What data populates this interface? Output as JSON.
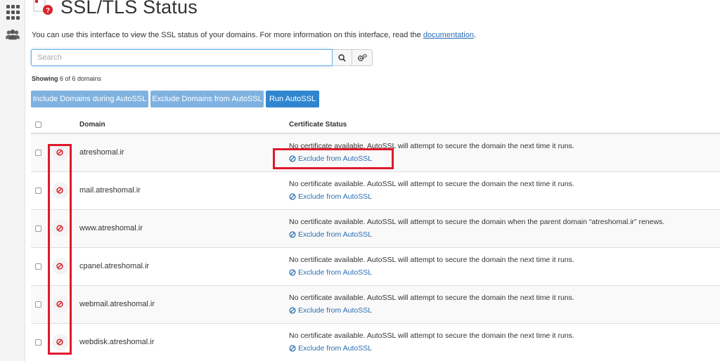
{
  "page": {
    "title": "SSL/TLS Status",
    "intro_text": "You can use this interface to view the SSL status of your domains. For more information on this interface, read the ",
    "intro_link": "documentation",
    "intro_end": "."
  },
  "sidebar": {
    "icons": [
      "grid-icon",
      "users-icon"
    ]
  },
  "search": {
    "placeholder": "Search",
    "value": ""
  },
  "showing": {
    "label": "Showing",
    "text": "6 of 6 domains"
  },
  "actions": {
    "include": "Include Domains during AutoSSL",
    "exclude": "Exclude Domains from AutoSSL",
    "run": "Run AutoSSL"
  },
  "table": {
    "headers": {
      "domain": "Domain",
      "status": "Certificate Status"
    },
    "rows": [
      {
        "domain": "atreshomal.ir",
        "message": "No certificate available. AutoSSL will attempt to secure the domain the next time it runs.",
        "link": "Exclude from AutoSSL"
      },
      {
        "domain": "mail.atreshomal.ir",
        "message": "No certificate available. AutoSSL will attempt to secure the domain the next time it runs.",
        "link": "Exclude from AutoSSL"
      },
      {
        "domain": "www.atreshomal.ir",
        "message": "No certificate available. AutoSSL will attempt to secure the domain when the parent domain “atreshomal.ir” renews.",
        "link": "Exclude from AutoSSL"
      },
      {
        "domain": "cpanel.atreshomal.ir",
        "message": "No certificate available. AutoSSL will attempt to secure the domain the next time it runs.",
        "link": "Exclude from AutoSSL"
      },
      {
        "domain": "webmail.atreshomal.ir",
        "message": "No certificate available. AutoSSL will attempt to secure the domain the next time it runs.",
        "link": "Exclude from AutoSSL"
      },
      {
        "domain": "webdisk.atreshomal.ir",
        "message": "No certificate available. AutoSSL will attempt to secure the domain the next time it runs.",
        "link": "Exclude from AutoSSL"
      }
    ]
  },
  "colors": {
    "accent": "#2f86cf",
    "accent_light": "#7fb2e0",
    "error": "#d9232e",
    "annotation": "#e0182d",
    "link": "#2a6db3"
  }
}
